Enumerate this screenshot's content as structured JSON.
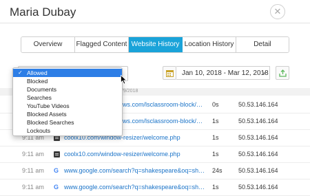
{
  "header": {
    "title": "Maria Dubay",
    "close_icon": "close-icon"
  },
  "tabs": [
    {
      "label": "Overview",
      "active": false
    },
    {
      "label": "Flagged Content",
      "active": false
    },
    {
      "label": "Website History",
      "active": true
    },
    {
      "label": "Location History",
      "active": false
    },
    {
      "label": "Detail",
      "active": false
    }
  ],
  "filter": {
    "selected": "Allowed",
    "options": [
      "Allowed",
      "Blocked",
      "Documents",
      "Searches",
      "YouTube Videos",
      "Blocked Assets",
      "Blocked Searches",
      "Lockouts"
    ]
  },
  "date_range": {
    "value": "Jan 10, 2018 - Mar 12, 2018",
    "calendar_icon": "calendar-icon",
    "export_icon": "export-icon"
  },
  "date_band": {
    "label": "/9/2018"
  },
  "rows": [
    {
      "time": "",
      "icon": "",
      "url": "ws.com/lsclassroom-block/cl...",
      "duration": "0s",
      "ip": "50.53.146.164"
    },
    {
      "time": "",
      "icon": "",
      "url": "ws.com/lsclassroom-block/cl...",
      "duration": "1s",
      "ip": "50.53.146.164"
    },
    {
      "time": "",
      "icon": "",
      "url": "",
      "duration": "",
      "ip": ""
    },
    {
      "time": "9:11 am",
      "icon": "document-icon",
      "url": "coolx10.com/window-resizer/welcome.php",
      "duration": "1s",
      "ip": "50.53.146.164"
    },
    {
      "time": "9:11 am",
      "icon": "document-icon",
      "url": "coolx10.com/window-resizer/welcome.php",
      "duration": "1s",
      "ip": "50.53.146.164"
    },
    {
      "time": "9:11 am",
      "icon": "google-icon",
      "url": "www.google.com/search?q=shakespeare&oq=shak...",
      "duration": "24s",
      "ip": "50.53.146.164"
    },
    {
      "time": "9:11 am",
      "icon": "google-icon",
      "url": "www.google.com/search?q=shakespeare&oq=shak...",
      "duration": "1s",
      "ip": "50.53.146.164"
    }
  ],
  "colors": {
    "accent": "#1aa3d9",
    "link": "#1a73c8",
    "selection": "#2d7ee6"
  }
}
